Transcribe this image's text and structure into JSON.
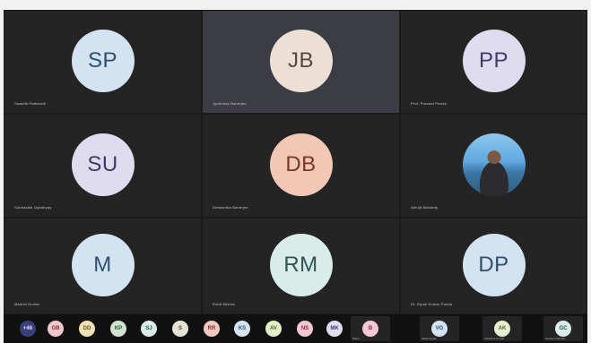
{
  "participants": [
    {
      "initials": "SP",
      "name": "Swastik Pattanaik",
      "avatar_bg": "#d3e3f1",
      "text": "#2f4f6f"
    },
    {
      "initials": "JB",
      "name": "Jyotirmay Banerjee",
      "avatar_bg": "#ece0d6",
      "text": "#5b4638",
      "highlight": true
    },
    {
      "initials": "PP",
      "name": "Prof. Pramod Parida",
      "avatar_bg": "#dfdcf0",
      "text": "#3f3a66"
    },
    {
      "initials": "SU",
      "name": "Subhasish Upadhyay",
      "avatar_bg": "#dfdcf0",
      "text": "#3f3a66"
    },
    {
      "initials": "DB",
      "name": "Debasmita Banerjee",
      "avatar_bg": "#f2c7b6",
      "text": "#7a3825"
    },
    {
      "initials": "",
      "name": "Abhijit Mohanty",
      "photo": true
    },
    {
      "initials": "M",
      "name": "Manish Kumar",
      "avatar_bg": "#d3e3f1",
      "text": "#2f4f6f"
    },
    {
      "initials": "RM",
      "name": "Rohit Mishra",
      "avatar_bg": "#d9ecea",
      "text": "#2f5552"
    },
    {
      "initials": "DP",
      "name": "Dr. Dipak Kumar Panda",
      "avatar_bg": "#d3e3f1",
      "text": "#2f4f6f"
    }
  ],
  "strip": {
    "overflow_label": "+46",
    "minis": [
      {
        "initials": "GB",
        "bg": "#f2c7cc",
        "text": "#7a2e3a"
      },
      {
        "initials": "DD",
        "bg": "#f0e1b3",
        "text": "#6b5420"
      },
      {
        "initials": "KP",
        "bg": "#cfe3cf",
        "text": "#2e5a2e"
      },
      {
        "initials": "SJ",
        "bg": "#d9ecea",
        "text": "#2f5552"
      },
      {
        "initials": "S",
        "bg": "#e6e2d6",
        "text": "#4d4736"
      },
      {
        "initials": "RR",
        "bg": "#f2c7c0",
        "text": "#7a3328"
      },
      {
        "initials": "KS",
        "bg": "#d3e3f1",
        "text": "#2f4f6f"
      },
      {
        "initials": "AV",
        "bg": "#e1efc7",
        "text": "#4b6120"
      },
      {
        "initials": "NS",
        "bg": "#f4c6d0",
        "text": "#7a2e45"
      },
      {
        "initials": "MK",
        "bg": "#e1dcf0",
        "text": "#3f3a66"
      }
    ],
    "pills": [
      {
        "initials": "B",
        "name": "Bablu",
        "bg": "#f4c6d6",
        "text": "#7a2e45"
      },
      {
        "initials": "VG",
        "name": "Vikas Gupta",
        "bg": "#d3e3f1",
        "text": "#2f4f6f"
      },
      {
        "initials": "AK",
        "name": "Abhishek Kumar",
        "bg": "#e6efd0",
        "text": "#4b6120"
      },
      {
        "initials": "GC",
        "name": "Gaurav Chandra",
        "bg": "#d9ecea",
        "text": "#2f5552"
      }
    ]
  }
}
